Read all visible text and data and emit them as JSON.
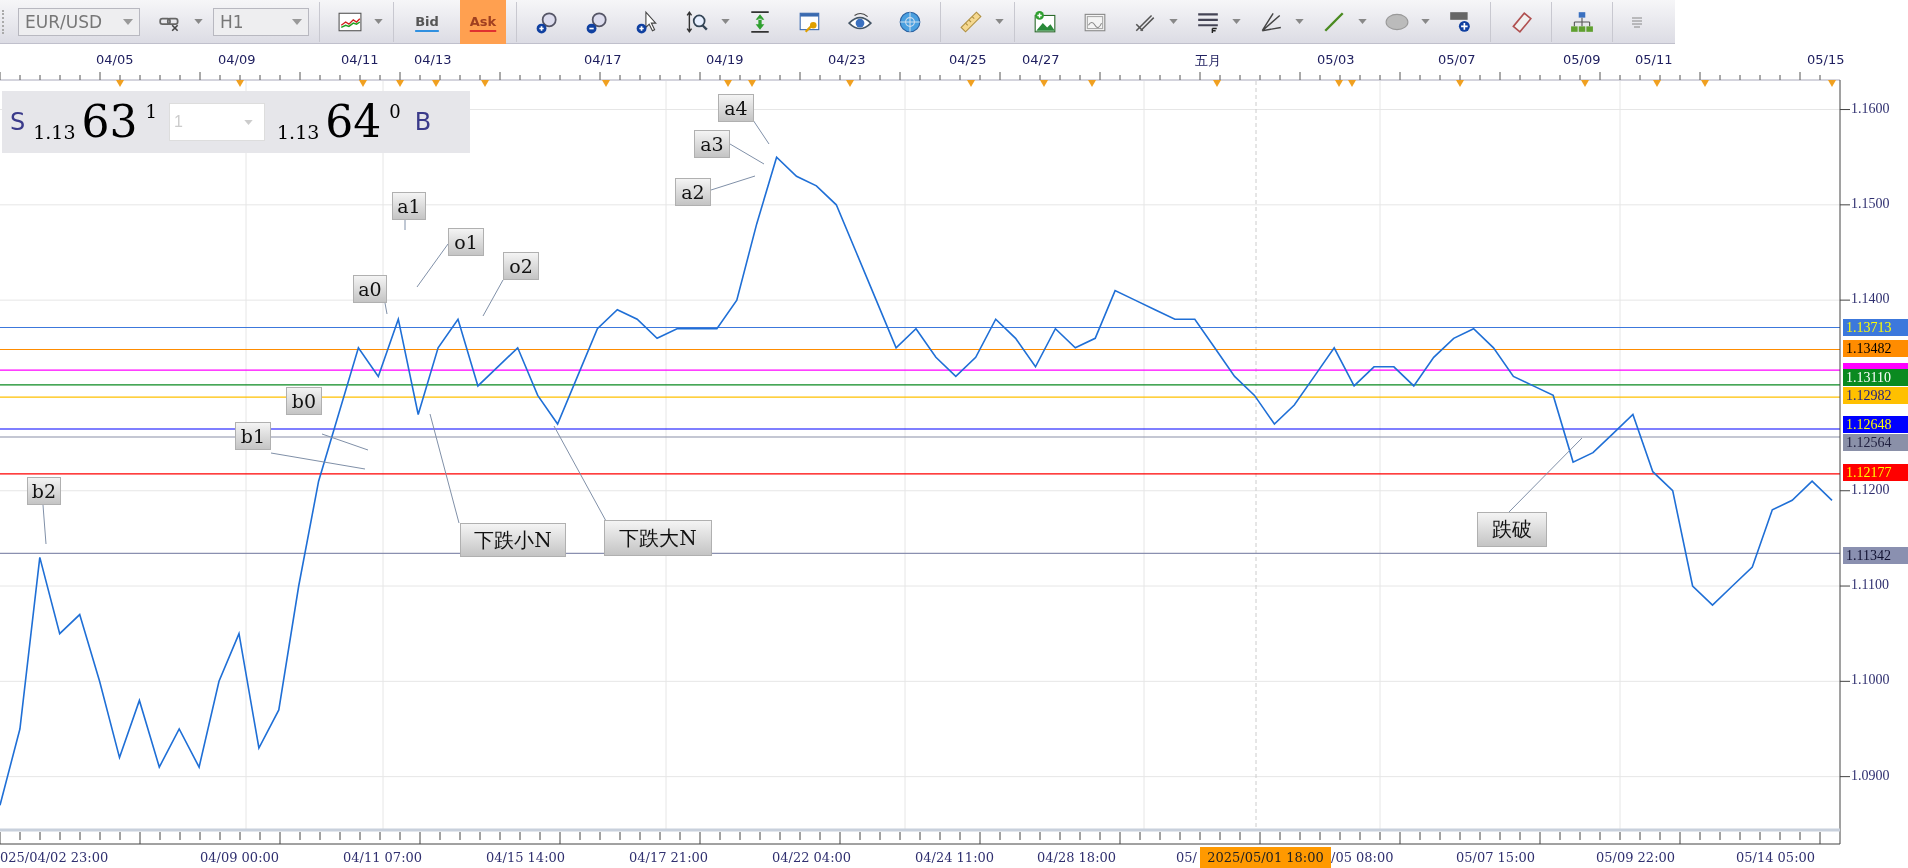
{
  "toolbar": {
    "symbol": "EUR/USD",
    "timeframe": "H1",
    "price_buttons": [
      {
        "label": "Bid",
        "selected": false
      },
      {
        "label": "Ask",
        "selected": true
      }
    ]
  },
  "top_axis": {
    "labels": [
      "04/05",
      "04/09",
      "04/11",
      "04/13",
      "04/17",
      "04/19",
      "04/23",
      "04/25",
      "04/27",
      "五月",
      "05/03",
      "05/07",
      "05/09",
      "05/11",
      "05/15"
    ]
  },
  "quote_panel": {
    "sell_label": "S",
    "bid_prefix": "1.13",
    "bid_big": "63",
    "bid_pip": "1",
    "lot_placeholder": "1",
    "ask_prefix": "1.13",
    "ask_big": "64",
    "ask_pip": "0",
    "buy_label": "B"
  },
  "chart": {
    "chart_data": {
      "type": "line",
      "grid": true,
      "ylim": [
        1.0844,
        1.1631
      ],
      "ref_lines": [
        {
          "axis": "y",
          "value": 1.13713,
          "label": "1.13713",
          "color": "#3c78dc"
        },
        {
          "axis": "y",
          "value": 1.13482,
          "label": "1.13482",
          "color": "#ff8c00"
        },
        {
          "axis": "y",
          "value": 1.13265,
          "color": "#ff00ff"
        },
        {
          "axis": "y",
          "value": 1.1311,
          "label": "1.13110",
          "color": "#0a8a20"
        },
        {
          "axis": "y",
          "value": 1.12982,
          "label": "1.12982",
          "color": "#ffc000"
        },
        {
          "axis": "y",
          "value": 1.12648,
          "label": "1.12648",
          "color": "#0000ff"
        },
        {
          "axis": "y",
          "value": 1.12564,
          "label": "1.12564",
          "color": "#8a90a8"
        },
        {
          "axis": "y",
          "value": 1.12177,
          "label": "1.12177",
          "color": "#ff0000"
        },
        {
          "axis": "y",
          "value": 1.11342,
          "label": "1.11342",
          "color": "#8a90b0"
        }
      ],
      "yticks": [
        {
          "value": 1.09,
          "label": "1.0900"
        },
        {
          "value": 1.1,
          "label": "1.1000"
        },
        {
          "value": 1.11,
          "label": "1.1100"
        },
        {
          "value": 1.12,
          "label": "1.1200"
        },
        {
          "value": 1.14,
          "label": "1.1400"
        },
        {
          "value": 1.15,
          "label": "1.1500"
        },
        {
          "value": 1.16,
          "label": "1.1600"
        }
      ],
      "series": [
        {
          "color": "#1f6fd6",
          "values": [
            1.087,
            1.095,
            1.113,
            1.105,
            1.107,
            1.1,
            1.092,
            1.098,
            1.091,
            1.095,
            1.091,
            1.1,
            1.105,
            1.093,
            1.097,
            1.11,
            1.121,
            1.128,
            1.135,
            1.132,
            1.138,
            1.128,
            1.135,
            1.138,
            1.131,
            1.133,
            1.135,
            1.13,
            1.127,
            1.132,
            1.137,
            1.139,
            1.138,
            1.136,
            1.137,
            1.137,
            1.137,
            1.14,
            1.148,
            1.155,
            1.153,
            1.152,
            1.15,
            1.145,
            1.14,
            1.135,
            1.137,
            1.134,
            1.132,
            1.134,
            1.138,
            1.136,
            1.133,
            1.137,
            1.135,
            1.136,
            1.141,
            1.14,
            1.139,
            1.138,
            1.138,
            1.135,
            1.132,
            1.13,
            1.127,
            1.129,
            1.132,
            1.135,
            1.131,
            1.133,
            1.133,
            1.131,
            1.134,
            1.136,
            1.137,
            1.135,
            1.132,
            1.131,
            1.13,
            1.123,
            1.124,
            1.126,
            1.128,
            1.122,
            1.12,
            1.11,
            1.108,
            1.11,
            1.112,
            1.118,
            1.119,
            1.121,
            1.119
          ]
        }
      ]
    },
    "annotations": [
      "b2",
      "a0",
      "a1",
      "o1",
      "o2",
      "b0",
      "b1",
      "a2",
      "a3",
      "a4",
      "下跌小N",
      "下跌大N",
      "跌破"
    ],
    "bottom_axis": {
      "labels": [
        "025/04/02 23:00",
        "04/09 00:00",
        "04/11 07:00",
        "04/15 14:00",
        "04/17 21:00",
        "04/22 04:00",
        "04/24 11:00",
        "04/28 18:00",
        "05/",
        "/05 08:00",
        "05/07 15:00",
        "05/09 22:00",
        "05/14 05:00"
      ],
      "cursor_label": "2025/05/01 18:00"
    }
  }
}
